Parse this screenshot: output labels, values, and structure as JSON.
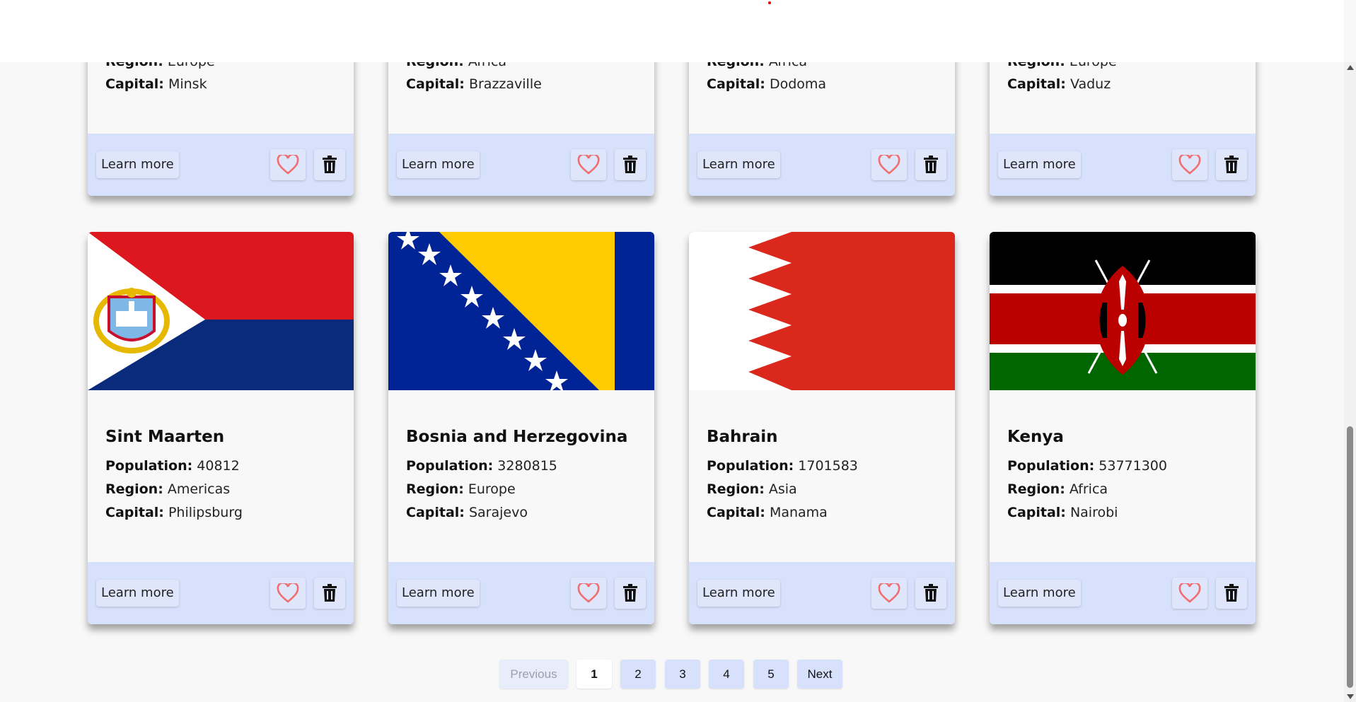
{
  "labels": {
    "population": "Population:",
    "region": "Region:",
    "capital": "Capital:",
    "learn_more": "Learn more"
  },
  "top_cards": [
    {
      "region": "Europe",
      "capital": "Minsk"
    },
    {
      "region": "Africa",
      "capital": "Brazzaville"
    },
    {
      "region": "Africa",
      "capital": "Dodoma"
    },
    {
      "region": "Europe",
      "capital": "Vaduz"
    }
  ],
  "cards": [
    {
      "name": "Sint Maarten",
      "population": "40812",
      "region": "Americas",
      "capital": "Philipsburg",
      "flag": "sint-maarten-flag"
    },
    {
      "name": "Bosnia and Herzegovina",
      "population": "3280815",
      "region": "Europe",
      "capital": "Sarajevo",
      "flag": "bosnia-flag"
    },
    {
      "name": "Bahrain",
      "population": "1701583",
      "region": "Asia",
      "capital": "Manama",
      "flag": "bahrain-flag"
    },
    {
      "name": "Kenya",
      "population": "53771300",
      "region": "Africa",
      "capital": "Nairobi",
      "flag": "kenya-flag"
    }
  ],
  "pagination": {
    "previous": "Previous",
    "pages": [
      "1",
      "2",
      "3",
      "4",
      "5"
    ],
    "current": "1",
    "next": "Next"
  },
  "colors": {
    "card_footer": "#d8e1fb",
    "heart": "#f26d6d",
    "accent_dot": "#e00000"
  }
}
